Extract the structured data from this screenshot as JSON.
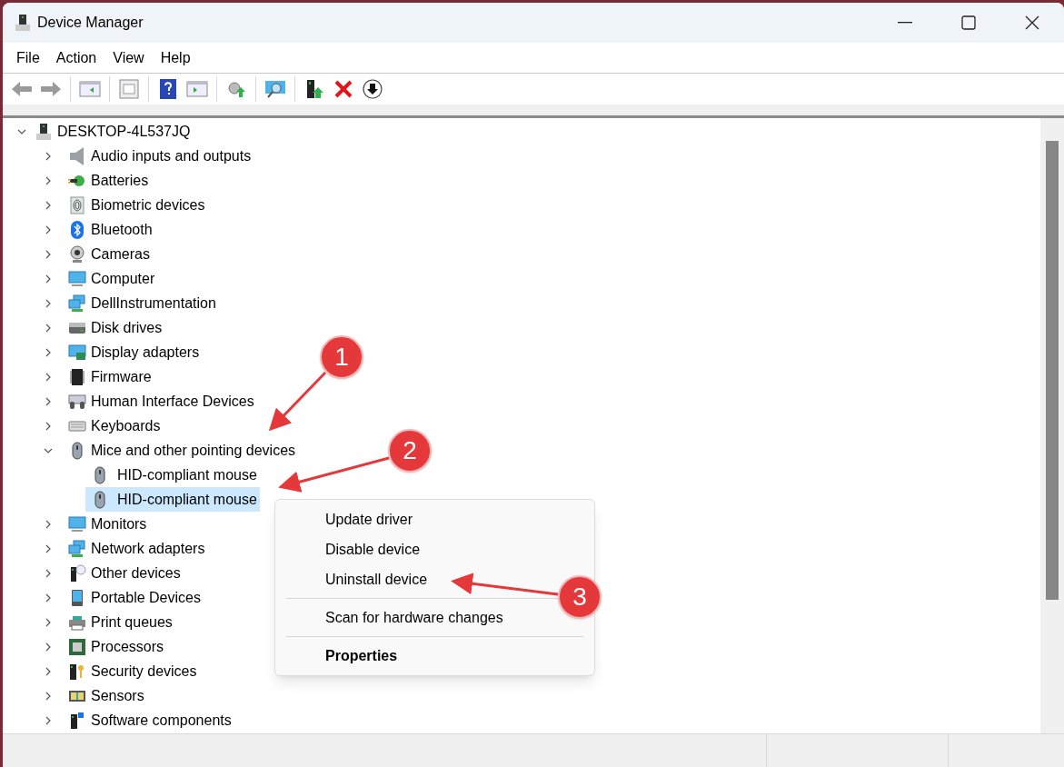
{
  "window": {
    "title": "Device Manager"
  },
  "menu": [
    "File",
    "Action",
    "View",
    "Help"
  ],
  "tree": {
    "label": "DESKTOP-4L537JQ",
    "expanded": true,
    "children": [
      {
        "label": "Audio inputs and outputs",
        "expanded": false
      },
      {
        "label": "Batteries",
        "expanded": false
      },
      {
        "label": "Biometric devices",
        "expanded": false
      },
      {
        "label": "Bluetooth",
        "expanded": false
      },
      {
        "label": "Cameras",
        "expanded": false
      },
      {
        "label": "Computer",
        "expanded": false
      },
      {
        "label": "DellInstrumentation",
        "expanded": false
      },
      {
        "label": "Disk drives",
        "expanded": false
      },
      {
        "label": "Display adapters",
        "expanded": false
      },
      {
        "label": "Firmware",
        "expanded": false
      },
      {
        "label": "Human Interface Devices",
        "expanded": false
      },
      {
        "label": "Keyboards",
        "expanded": false
      },
      {
        "label": "Mice and other pointing devices",
        "expanded": true,
        "children": [
          {
            "label": "HID-compliant mouse",
            "selected": false
          },
          {
            "label": "HID-compliant mouse",
            "selected": true
          }
        ]
      },
      {
        "label": "Monitors",
        "expanded": false
      },
      {
        "label": "Network adapters",
        "expanded": false
      },
      {
        "label": "Other devices",
        "expanded": false
      },
      {
        "label": "Portable Devices",
        "expanded": false
      },
      {
        "label": "Print queues",
        "expanded": false
      },
      {
        "label": "Processors",
        "expanded": false
      },
      {
        "label": "Security devices",
        "expanded": false
      },
      {
        "label": "Sensors",
        "expanded": false
      },
      {
        "label": "Software components",
        "expanded": false
      }
    ]
  },
  "context_menu": [
    {
      "kind": "item",
      "label": "Update driver"
    },
    {
      "kind": "item",
      "label": "Disable device"
    },
    {
      "kind": "item",
      "label": "Uninstall device"
    },
    {
      "kind": "separator"
    },
    {
      "kind": "item",
      "label": "Scan for hardware changes"
    },
    {
      "kind": "separator"
    },
    {
      "kind": "default",
      "label": "Properties"
    }
  ],
  "callouts": [
    "1",
    "2",
    "3"
  ]
}
